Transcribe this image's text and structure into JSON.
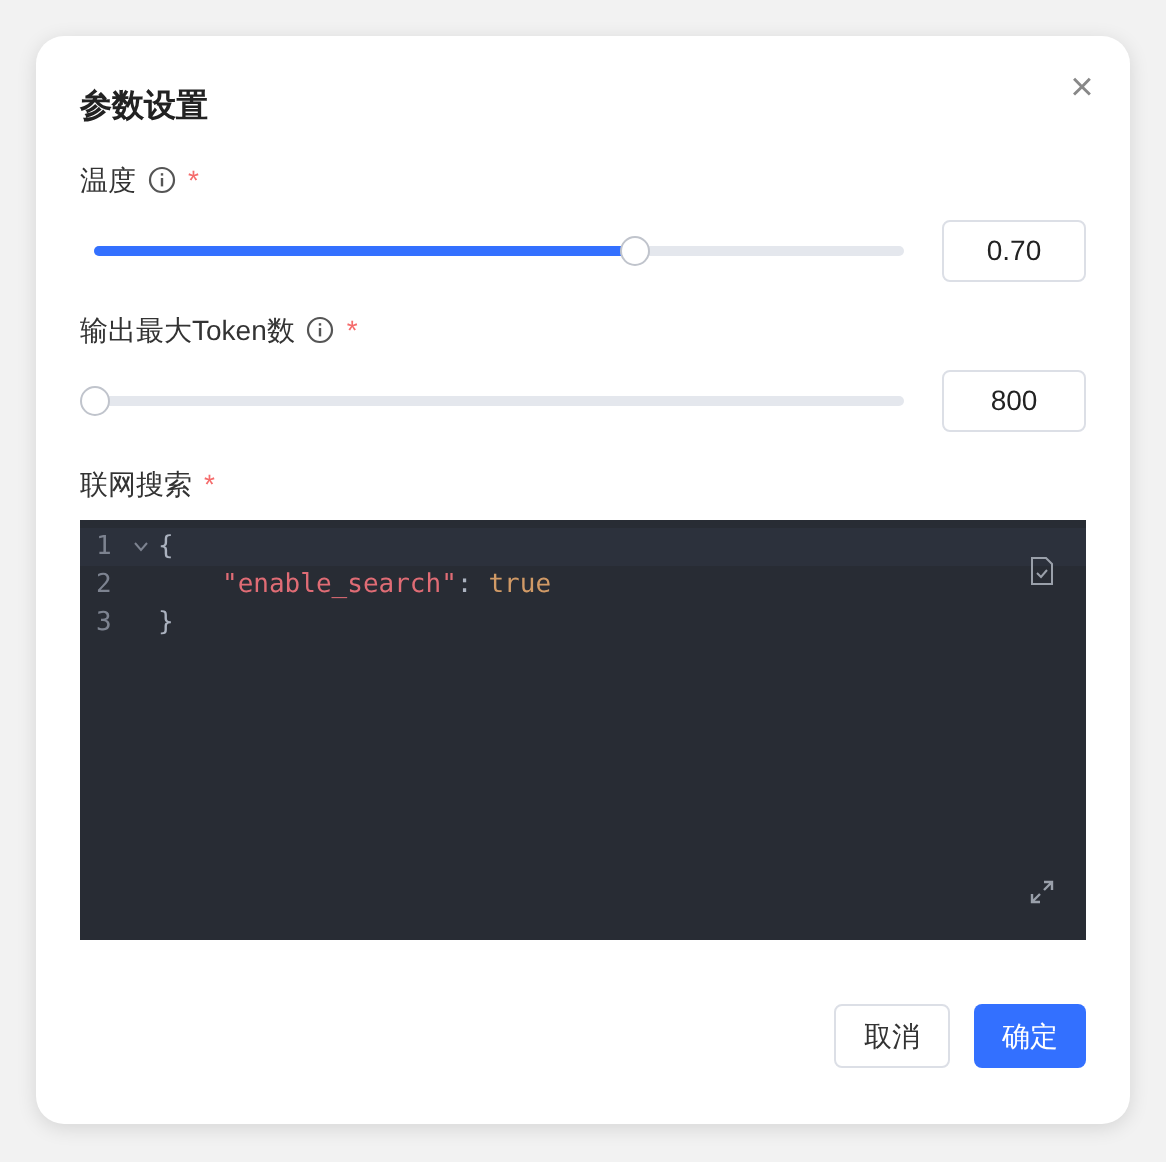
{
  "dialog": {
    "title": "参数设置",
    "close": "×"
  },
  "sliders": [
    {
      "label": "温度",
      "required_mark": "*",
      "info": true,
      "level": 0.667,
      "value": "0.70"
    },
    {
      "label": "输出最大Token数",
      "required_mark": "*",
      "info": true,
      "level": 0,
      "value": "800"
    }
  ],
  "editor": {
    "label": "联网搜索",
    "required_mark": "*",
    "lines": [
      {
        "number": "1",
        "fold": true,
        "active": true,
        "tokens": [
          {
            "kind": "punct",
            "text": "{"
          }
        ]
      },
      {
        "number": "2",
        "fold": false,
        "active": false,
        "tokens": [
          {
            "kind": "key",
            "text": "\"enable_search\""
          },
          {
            "kind": "punct",
            "text": ":"
          },
          {
            "kind": "bool",
            "text": "true"
          }
        ]
      },
      {
        "number": "3",
        "fold": false,
        "active": false,
        "tokens": [
          {
            "kind": "punct",
            "text": "}"
          }
        ]
      }
    ]
  },
  "buttons": [
    {
      "label": "取消",
      "primary": false
    },
    {
      "label": "确定",
      "primary": true
    }
  ]
}
